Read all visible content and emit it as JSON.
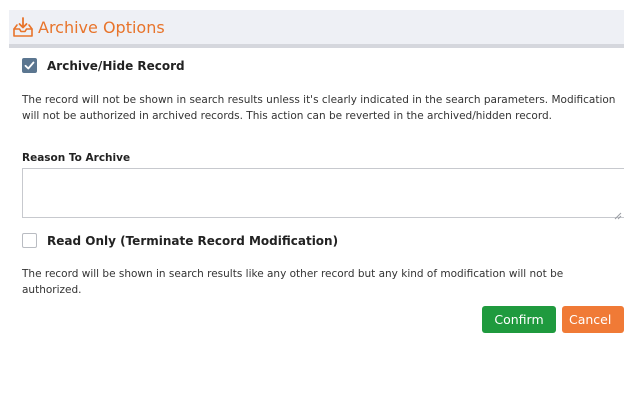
{
  "header": {
    "title": "Archive Options",
    "icon": "archive-download-icon",
    "accent_color": "#e8742b"
  },
  "archive_option": {
    "label": "Archive/Hide Record",
    "checked": true,
    "description": "The record will not be shown in search results unless it's clearly indicated in the search parameters. Modification will not be authorized in archived records. This action can be reverted in the archived/hidden record.",
    "reason_label": "Reason To Archive",
    "reason_value": "",
    "reason_placeholder": ""
  },
  "readonly_option": {
    "label": "Read Only (Terminate Record Modification)",
    "checked": false,
    "description": "The record will be shown in search results like any other record but any kind of modification will not be authorized."
  },
  "actions": {
    "confirm_label": "Confirm",
    "confirm_color": "#1f9a3e",
    "cancel_label": "Cancel",
    "cancel_color": "#f07a36"
  }
}
